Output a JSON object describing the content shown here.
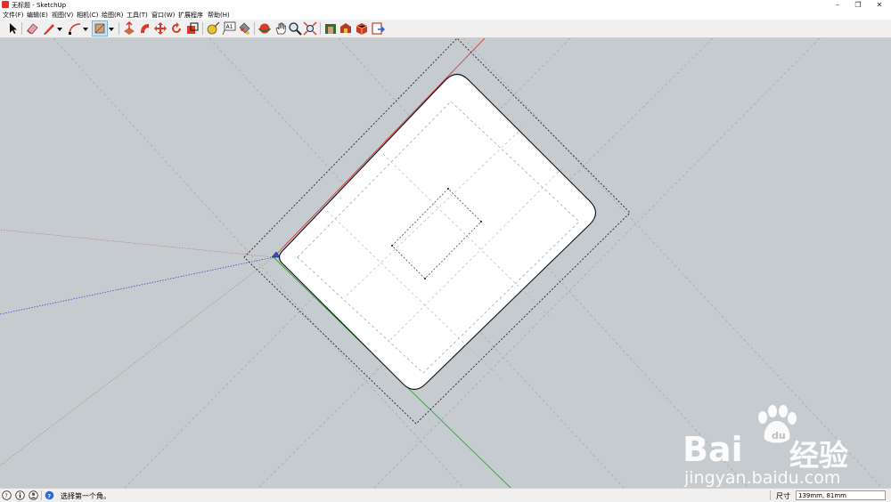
{
  "window": {
    "title": "无标题 - SketchUp"
  },
  "menu": [
    "文件(F)",
    "编辑(E)",
    "视图(V)",
    "相机(C)",
    "绘图(R)",
    "工具(T)",
    "窗口(W)",
    "扩展程序",
    "帮助(H)"
  ],
  "toolbar": {
    "tools": [
      "select-tool",
      "eraser-tool",
      "pencil-line-tool",
      "arc-tool",
      "rectangle-tool",
      "push-pull-tool",
      "follow-me-tool",
      "move-tool",
      "rotate-tool",
      "scale-tool",
      "tape-measure-tool",
      "text-tool",
      "paint-bucket-tool",
      "orbit-tool",
      "pan-tool",
      "zoom-tool",
      "zoom-extents-tool",
      "3d-warehouse-tool",
      "extension-warehouse-tool",
      "sketchup-extension-tool",
      "layout-send-tool"
    ]
  },
  "status": {
    "prompt": "选择第一个角。",
    "measure_label": "尺寸",
    "measure_value": "139mm, 81mm"
  },
  "watermark": {
    "brand": "Bai",
    "brand_cn": "经验",
    "url": "jingyan.baidu.com"
  },
  "colors": {
    "viewport_bg": "#c5cbcf",
    "red_axis": "#d43a3a",
    "green_axis": "#2fa63a",
    "blue_axis": "#3a4bd4"
  }
}
